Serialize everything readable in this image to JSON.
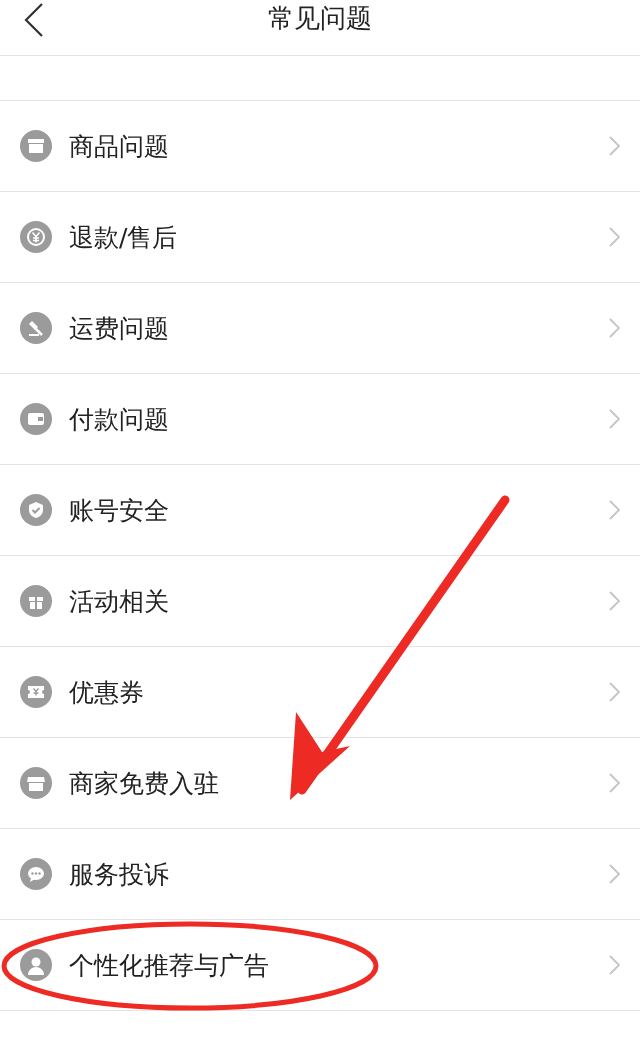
{
  "header": {
    "title": "常见问题"
  },
  "items": [
    {
      "label": "商品问题",
      "highlighted": false
    },
    {
      "label": "退款/售后",
      "highlighted": false
    },
    {
      "label": "运费问题",
      "highlighted": false
    },
    {
      "label": "付款问题",
      "highlighted": false
    },
    {
      "label": "账号安全",
      "highlighted": false
    },
    {
      "label": "活动相关",
      "highlighted": false
    },
    {
      "label": "优惠券",
      "highlighted": false
    },
    {
      "label": "商家免费入驻",
      "highlighted": false
    },
    {
      "label": "服务投诉",
      "highlighted": false
    },
    {
      "label": "个性化推荐与广告",
      "highlighted": true
    }
  ]
}
